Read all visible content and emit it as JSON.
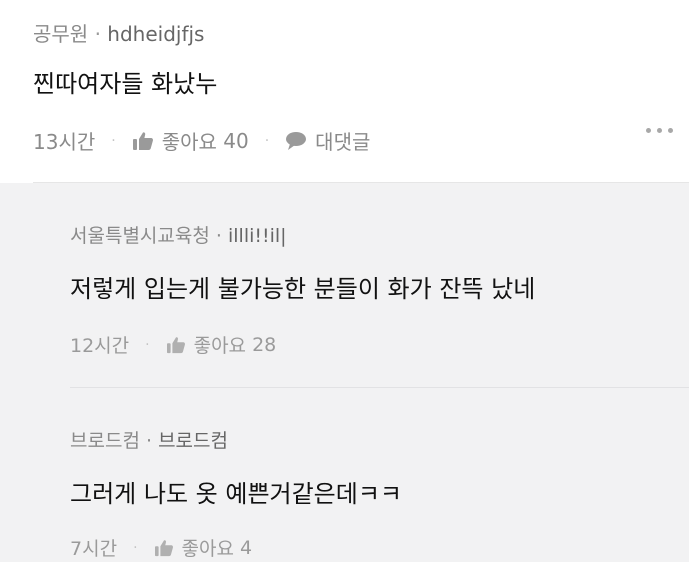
{
  "comment": {
    "author": "공무원",
    "separator": "·",
    "user_id": "hdheidjfjs",
    "text": "찐따여자들 화났누",
    "time": "13시간",
    "like_label": "좋아요",
    "like_count": "40",
    "reply_label": "대댓글"
  },
  "replies": [
    {
      "author": "서울특별시교육청",
      "separator": "·",
      "user_id": "illli!!il|",
      "text": "저렇게 입는게 불가능한 분들이 화가 잔뜩 났네",
      "time": "12시간",
      "like_label": "좋아요",
      "like_count": "28"
    },
    {
      "author": "브로드컴",
      "separator": "·",
      "user_id": "브로드컴",
      "text": "그러게 나도 옷 예쁜거같은데ㅋㅋ",
      "time": "7시간",
      "like_label": "좋아요",
      "like_count": "4"
    }
  ],
  "colors": {
    "meta_text": "#8a8a8a",
    "body_text": "#111111",
    "reply_background": "#f2f2f3"
  },
  "icons": [
    "thumbs-up-icon",
    "speech-bubble-icon",
    "more-dots-icon"
  ]
}
